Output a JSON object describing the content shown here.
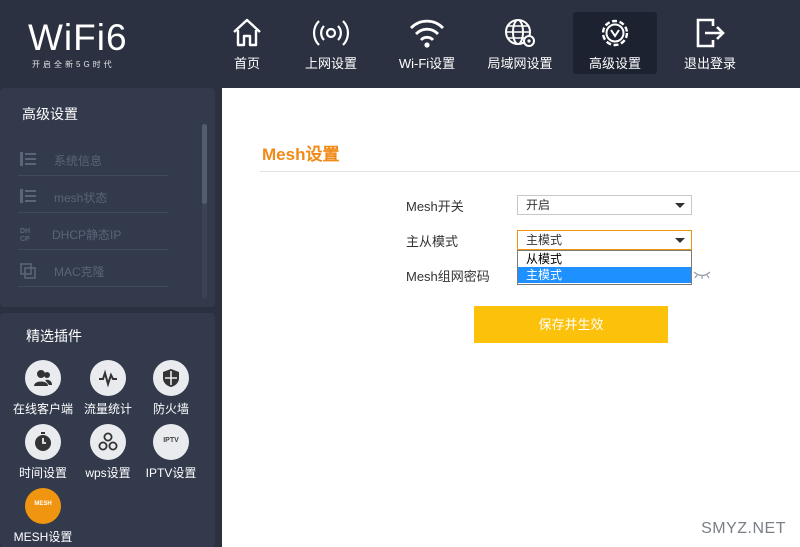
{
  "header": {
    "logo": "WiFi6",
    "tagline": "开启全新5G时代",
    "nav": [
      {
        "label": "首页",
        "icon": "home-icon"
      },
      {
        "label": "上网设置",
        "icon": "signal-icon"
      },
      {
        "label": "Wi-Fi设置",
        "icon": "wifi-icon"
      },
      {
        "label": "局域网设置",
        "icon": "lan-globe-icon"
      },
      {
        "label": "高级设置",
        "icon": "gear-icon",
        "active": true
      },
      {
        "label": "退出登录",
        "icon": "logout-icon"
      }
    ]
  },
  "sidebar": {
    "title": "高级设置",
    "items": [
      {
        "label": "系统信息",
        "icon": "list-icon"
      },
      {
        "label": "mesh状态",
        "icon": "list-icon"
      },
      {
        "label": "DHCP静态IP",
        "icon": "dhcp-icon"
      },
      {
        "label": "MAC克隆",
        "icon": "clone-icon"
      }
    ]
  },
  "plugins": {
    "title": "精选插件",
    "items": [
      {
        "label": "在线客户端",
        "icon": "users-icon"
      },
      {
        "label": "流量统计",
        "icon": "traffic-icon"
      },
      {
        "label": "防火墙",
        "icon": "shield-icon"
      },
      {
        "label": "时间设置",
        "icon": "clock-icon"
      },
      {
        "label": "wps设置",
        "icon": "wps-icon"
      },
      {
        "label": "IPTV设置",
        "icon": "iptv-icon",
        "badge": "IPTV"
      },
      {
        "label": "MESH设置",
        "icon": "mesh-icon",
        "badge": "MESH",
        "active": true
      }
    ]
  },
  "main": {
    "title": "Mesh设置",
    "fields": {
      "mesh_switch": {
        "label": "Mesh开关",
        "value": "开启"
      },
      "mode": {
        "label": "主从模式",
        "value": "主模式",
        "options": [
          "从模式",
          "主模式"
        ],
        "selected_index": 1
      },
      "password": {
        "label": "Mesh组网密码"
      }
    },
    "save_label": "保存并生效"
  },
  "watermark": "SMYZ.NET",
  "colors": {
    "accent": "#f08a18",
    "button": "#fcc10b",
    "header_bg": "#2b3140",
    "panel_bg": "#323a4c",
    "dropdown_selected": "#1e90ff"
  }
}
